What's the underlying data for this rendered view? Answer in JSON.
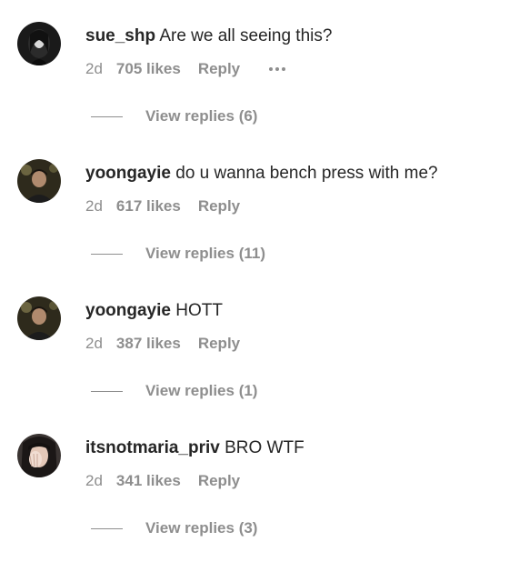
{
  "comments": [
    {
      "username": "sue_shp",
      "text": "Are we all seeing this?",
      "time": "2d",
      "likes": "705 likes",
      "reply": "Reply",
      "view_replies": "View replies (6)",
      "avatar_icon": "avatar-dark-hair-icon"
    },
    {
      "username": "yoongayie",
      "text": "do u wanna bench press with me?",
      "time": "2d",
      "likes": "617 likes",
      "reply": "Reply",
      "view_replies": "View replies (11)",
      "avatar_icon": "avatar-portrait-icon"
    },
    {
      "username": "yoongayie",
      "text": "HOTT",
      "time": "2d",
      "likes": "387 likes",
      "reply": "Reply",
      "view_replies": "View replies (1)",
      "avatar_icon": "avatar-portrait-icon"
    },
    {
      "username": "itsnotmaria_priv",
      "text": "BRO WTF",
      "time": "2d",
      "likes": "341 likes",
      "reply": "Reply",
      "view_replies": "View replies (3)",
      "avatar_icon": "avatar-hand-face-icon"
    }
  ],
  "more_options_icon": "more-horizontal-icon",
  "colors": {
    "text": "#262626",
    "secondary": "#8e8e8e",
    "background": "#ffffff"
  }
}
